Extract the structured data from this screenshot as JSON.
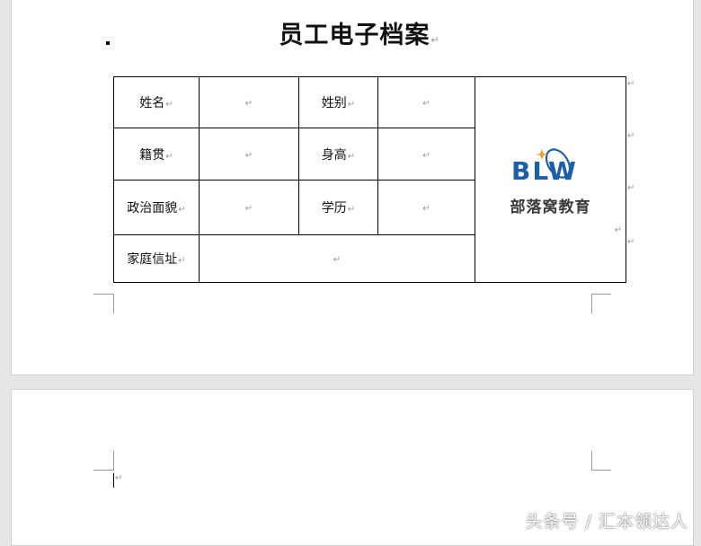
{
  "document": {
    "title": "员工电子档案",
    "para_mark": "↵"
  },
  "table": {
    "rows": [
      [
        {
          "label": "姓名",
          "value": ""
        },
        {
          "label": "姓别",
          "value": ""
        }
      ],
      [
        {
          "label": "籍贯",
          "value": ""
        },
        {
          "label": "身高",
          "value": ""
        }
      ],
      [
        {
          "label": "政治面貌",
          "value": ""
        },
        {
          "label": "学历",
          "value": ""
        }
      ],
      [
        {
          "label": "家庭信址",
          "value": ""
        }
      ]
    ],
    "photo": {
      "logo_text": "BLW",
      "logo_subtext": "部落窝教育",
      "logo_color": "#1a5fa8",
      "accent_color": "#f0a030"
    }
  },
  "watermark": "头条号 / 汇本领达人"
}
